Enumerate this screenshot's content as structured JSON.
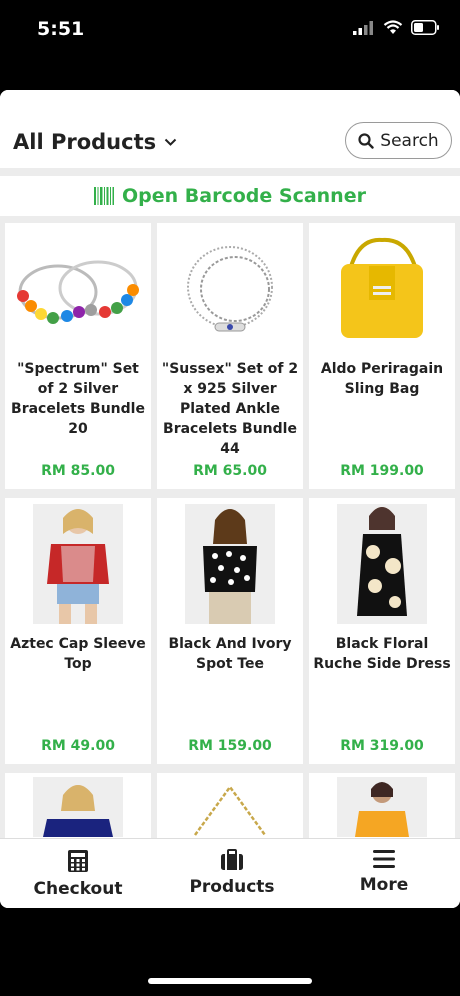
{
  "status": {
    "time": "5:51"
  },
  "header": {
    "title": "All Products",
    "search_label": "Search"
  },
  "scanner": {
    "label": "Open Barcode Scanner"
  },
  "products": [
    {
      "name": "\"Spectrum\" Set of 2 Silver Bracelets Bundle 20",
      "price": "RM 85.00",
      "image": "bracelets"
    },
    {
      "name": "\"Sussex\" Set of 2 x 925 Silver Plated Ankle Bracelets Bundle 44",
      "price": "RM 65.00",
      "image": "anklet"
    },
    {
      "name": "Aldo Periragain Sling Bag",
      "price": "RM 199.00",
      "image": "yellow-bag"
    },
    {
      "name": "Aztec Cap Sleeve Top",
      "price": "RM 49.00",
      "image": "model-red-top"
    },
    {
      "name": "Black And Ivory Spot Tee",
      "price": "RM 159.00",
      "image": "model-polka-tee"
    },
    {
      "name": "Black Floral Ruche Side Dress",
      "price": "RM 319.00",
      "image": "model-floral-dress"
    },
    {
      "name": "",
      "price": "",
      "image": "model-dark-top"
    },
    {
      "name": "",
      "price": "",
      "image": "gold-chain"
    },
    {
      "name": "",
      "price": "",
      "image": "model-yellow-top"
    }
  ],
  "tabs": [
    {
      "label": "Checkout",
      "icon": "calculator-icon"
    },
    {
      "label": "Products",
      "icon": "briefcase-icon"
    },
    {
      "label": "More",
      "icon": "menu-icon"
    }
  ],
  "colors": {
    "accent": "#33b04a",
    "background": "#ececec"
  }
}
